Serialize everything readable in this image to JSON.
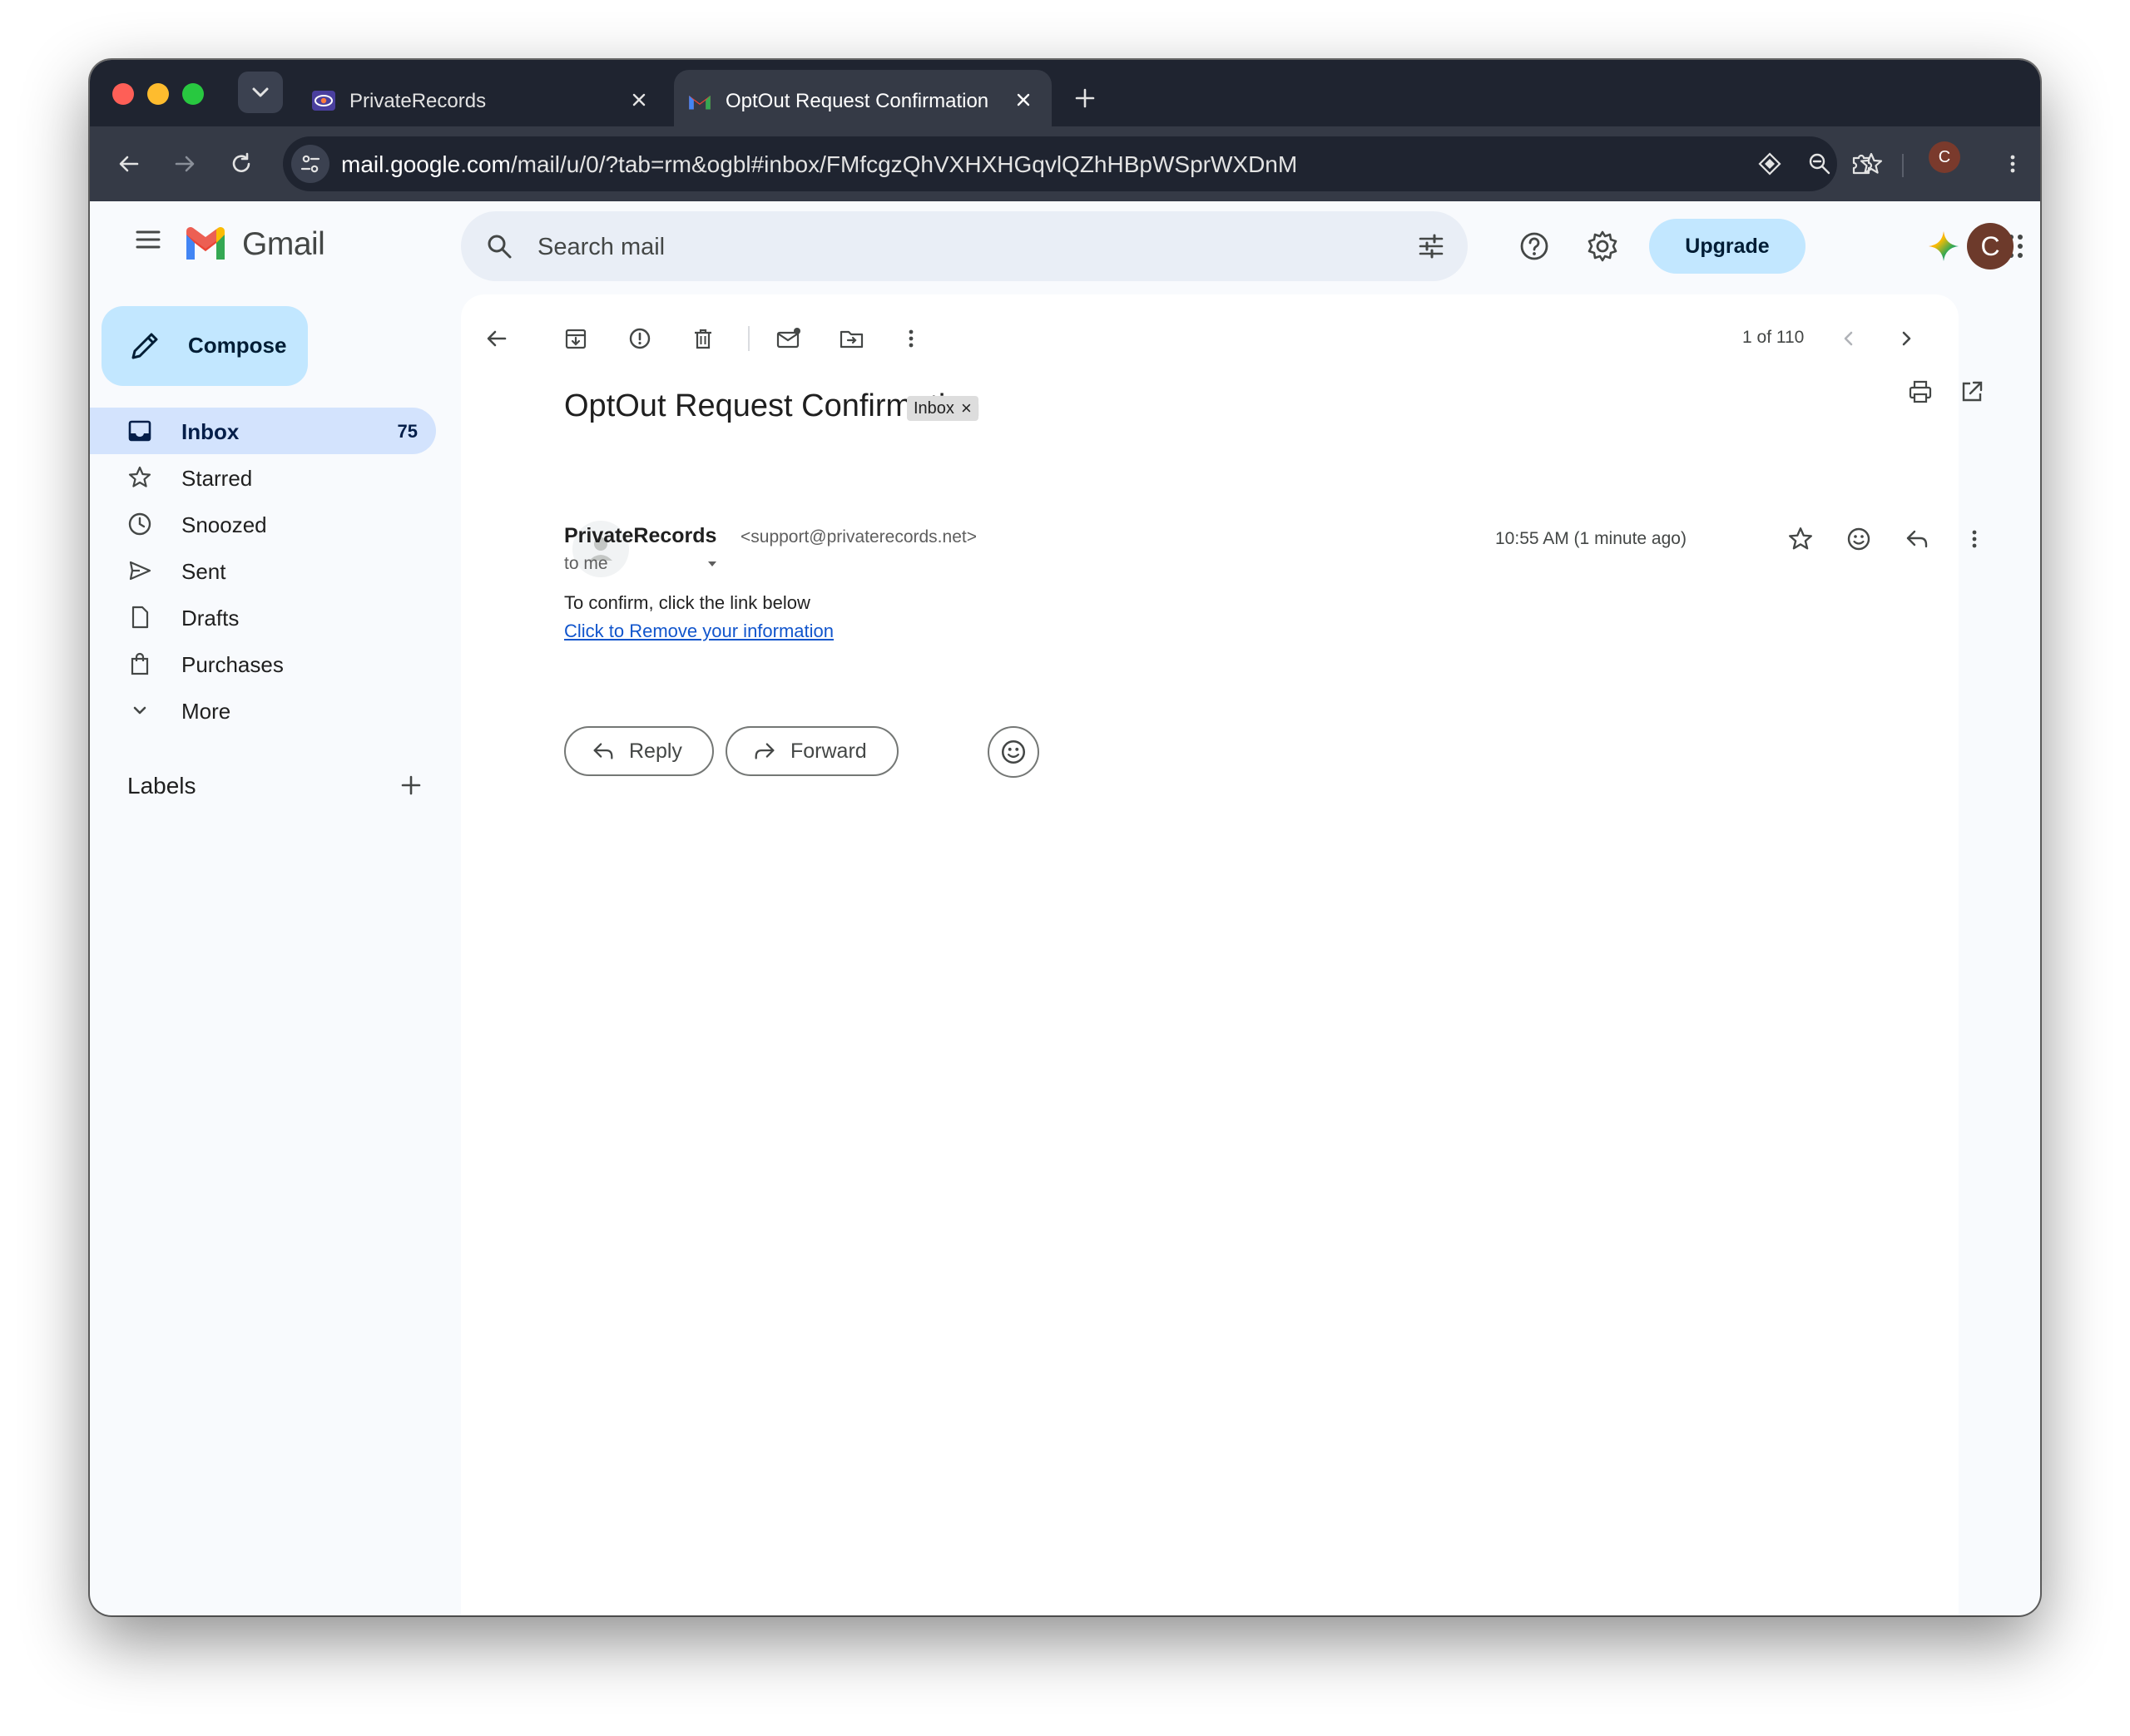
{
  "browser": {
    "tabs": [
      {
        "title": "PrivateRecords",
        "icon": "privaterecords-favicon"
      },
      {
        "title": "OptOut Request Confirmation",
        "icon": "gmail-favicon"
      }
    ],
    "url_host": "mail.google.com",
    "url_path": "/mail/u/0/?tab=rm&ogbl#inbox/FMfcgzQhVXHXHGqvlQZhHBpWSprWXDnM",
    "profile_initial": "C"
  },
  "header": {
    "product_name": "Gmail",
    "search_placeholder": "Search mail",
    "upgrade_label": "Upgrade",
    "avatar_initial": "C"
  },
  "sidebar": {
    "compose_label": "Compose",
    "items": [
      {
        "label": "Inbox",
        "count": "75",
        "icon": "inbox-icon",
        "active": true
      },
      {
        "label": "Starred",
        "count": "",
        "icon": "star-icon"
      },
      {
        "label": "Snoozed",
        "count": "",
        "icon": "clock-icon"
      },
      {
        "label": "Sent",
        "count": "",
        "icon": "send-icon"
      },
      {
        "label": "Drafts",
        "count": "",
        "icon": "draft-icon"
      },
      {
        "label": "Purchases",
        "count": "",
        "icon": "shopping-bag-icon"
      },
      {
        "label": "More",
        "count": "",
        "icon": "chevron-down-icon"
      }
    ],
    "labels_title": "Labels"
  },
  "toolbar": {
    "pager": "1 of 110"
  },
  "message": {
    "subject": "OptOut Request Confirmation",
    "label_chip": "Inbox",
    "sender_name": "PrivateRecords",
    "sender_email": "<support@privaterecords.net>",
    "recipient": "to me",
    "timestamp": "10:55 AM (1 minute ago)",
    "body_line": "To confirm, click the link below",
    "body_link": "Click to Remove your information",
    "reply_label": "Reply",
    "forward_label": "Forward"
  },
  "colors": {
    "accent": "#c2e7ff",
    "active_nav": "#d3e3fd",
    "link": "#1155cc",
    "chrome_dark": "#1f2430"
  }
}
